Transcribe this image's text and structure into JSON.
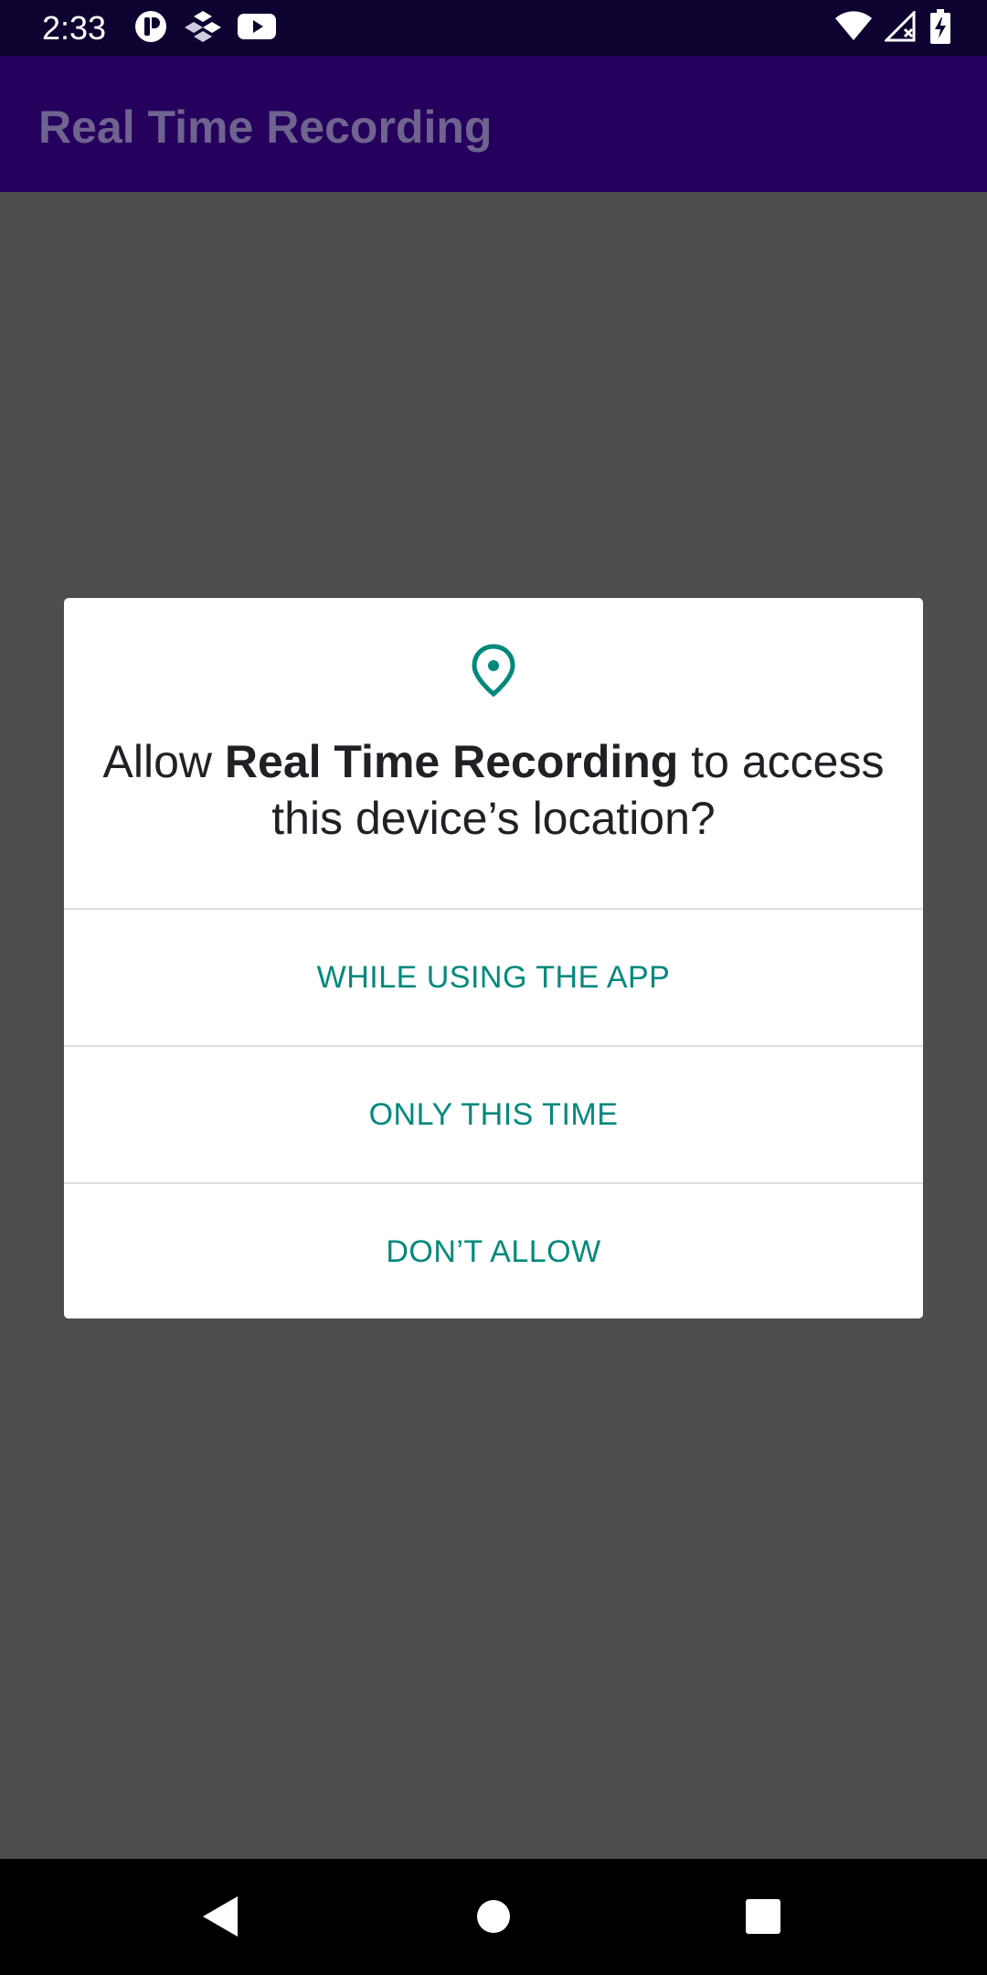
{
  "status_bar": {
    "time": "2:33",
    "left_icons": [
      "app-notification-icon",
      "widget-icon",
      "youtube-icon"
    ],
    "right_icons": [
      "wifi-icon",
      "signal-icon",
      "battery-charging-icon"
    ]
  },
  "app_bar": {
    "title": "Real Time Recording"
  },
  "dialog": {
    "icon": "location-pin-icon",
    "message_prefix": "Allow ",
    "message_app_name": "Real Time Recording",
    "message_suffix": " to access this device’s location?",
    "buttons": [
      {
        "label": "WHILE USING THE APP"
      },
      {
        "label": "ONLY THIS TIME"
      },
      {
        "label": "DON’T ALLOW"
      }
    ]
  },
  "nav_bar": {
    "buttons": [
      "back-icon",
      "home-icon",
      "recents-icon"
    ]
  },
  "colors": {
    "status_bar_bg": "#0e0330",
    "app_bar_bg": "#25005c",
    "scrim_bg": "#4d4d4d",
    "accent": "#00897b",
    "dialog_text": "#202124"
  }
}
